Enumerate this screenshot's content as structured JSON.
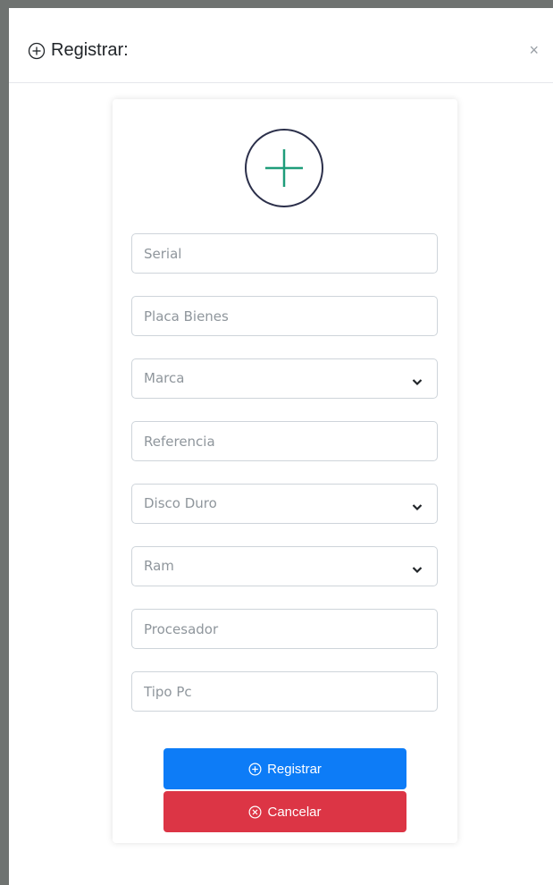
{
  "modal": {
    "title": "Registrar:",
    "close_label": "×"
  },
  "form": {
    "serial_placeholder": "Serial",
    "placa_placeholder": "Placa Bienes",
    "marca_selected": "Marca",
    "referencia_placeholder": "Referencia",
    "disco_selected": "Disco Duro",
    "ram_selected": "Ram",
    "procesador_placeholder": "Procesador",
    "tipo_pc_placeholder": "Tipo Pc"
  },
  "buttons": {
    "register_label": "Registrar",
    "cancel_label": "Cancelar"
  },
  "icons": {
    "title_icon": "plus-circle-icon",
    "hero_icon": "plus-circle-icon",
    "select_icon": "chevron-down-icon",
    "register_icon": "plus-circle-icon",
    "cancel_icon": "x-circle-icon"
  },
  "colors": {
    "primary": "#0d7cf7",
    "danger": "#dc3545",
    "hero_plus": "#1f9d7a",
    "hero_ring": "#2b2f4a"
  }
}
